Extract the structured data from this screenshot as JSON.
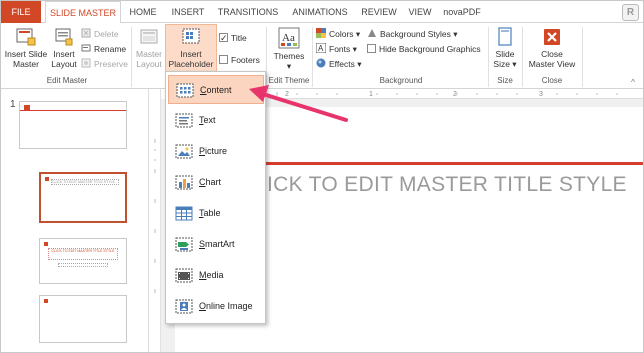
{
  "tabs": {
    "file": "FILE",
    "slide_master": "SLIDE MASTER",
    "home": "HOME",
    "insert": "INSERT",
    "transitions": "TRANSITIONS",
    "animations": "ANIMATIONS",
    "review": "REVIEW",
    "view": "VIEW",
    "novapdf": "novaPDF"
  },
  "badge": "R",
  "ribbon": {
    "edit_master": {
      "label": "Edit Master",
      "insert_slide_master": [
        "Insert Slide",
        "Master"
      ],
      "insert_layout": [
        "Insert",
        "Layout"
      ],
      "delete": "Delete",
      "rename": "Rename",
      "preserve": "Preserve"
    },
    "master_layout_group": {
      "master_layout": [
        "Master",
        "Layout"
      ],
      "insert_placeholder": [
        "Insert",
        "Placeholder ▾"
      ],
      "title": "Title",
      "footers": "Footers"
    },
    "edit_theme": {
      "label": "Edit Theme",
      "themes": [
        "Themes",
        "▾"
      ]
    },
    "background": {
      "label": "Background",
      "colors": "Colors ▾",
      "fonts": "Fonts ▾",
      "effects": "Effects ▾",
      "background_styles": "Background Styles ▾",
      "hide_background_graphics": "Hide Background Graphics"
    },
    "size": {
      "label": "Size",
      "slide_size": [
        "Slide",
        "Size ▾"
      ]
    },
    "close": {
      "label": "Close",
      "close_master_view": [
        "Close",
        "Master View"
      ]
    }
  },
  "ruler_ticks": [
    "2",
    "1",
    "2",
    "3"
  ],
  "thumbnails": {
    "slide_number": "1",
    "thumb2_text": "CLICK TO EDIT MASTER TITLE STYLE",
    "thumb3_text": "CLICK TO EDIT MASTER TITLE STYLE"
  },
  "slide": {
    "title": "ICK TO EDIT MASTER TITLE STYLE"
  },
  "dropdown": {
    "items": [
      {
        "key": "C",
        "rest": "ontent",
        "icon": "content-icon"
      },
      {
        "key": "T",
        "rest": "ext",
        "icon": "text-icon"
      },
      {
        "key": "P",
        "rest": "icture",
        "icon": "picture-icon"
      },
      {
        "key": "C",
        "rest": "hart",
        "icon": "chart-icon"
      },
      {
        "key": "T",
        "rest": "able",
        "icon": "table-icon"
      },
      {
        "key": "S",
        "rest": "martArt",
        "icon": "smartart-icon"
      },
      {
        "key": "M",
        "rest": "edia",
        "icon": "media-icon"
      },
      {
        "key": "O",
        "rest": "nline Image",
        "icon": "online-image-icon"
      }
    ]
  },
  "colors": {
    "accent": "#d24726",
    "highlight": "#fcd5c0",
    "arrow": "#e8336b",
    "title_bar_red": "#d63d2f"
  }
}
